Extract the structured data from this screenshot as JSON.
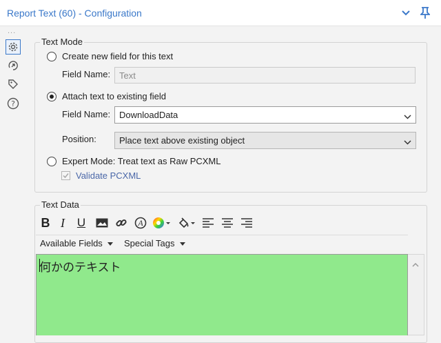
{
  "window": {
    "title": "Report Text (60) - Configuration"
  },
  "sidebar": {
    "dots": "...",
    "items": [
      "gear-icon",
      "connection-icon",
      "tag-icon",
      "help-icon"
    ]
  },
  "text_mode": {
    "legend": "Text Mode",
    "option_create": "Create new field for this text",
    "field_name_label_1": "Field Name:",
    "field_name_value_1": "Text",
    "option_attach": "Attach text to existing field",
    "field_name_label_2": "Field Name:",
    "field_name_value_2": "DownloadData",
    "position_label": "Position:",
    "position_value": "Place text above existing object",
    "option_expert": "Expert Mode: Treat text as Raw PCXML",
    "validate_label": "Validate PCXML",
    "selected_option": "attach"
  },
  "text_data": {
    "legend": "Text Data",
    "toolbar": [
      "bold",
      "italic",
      "underline",
      "image",
      "link",
      "font",
      "color",
      "fill",
      "align-left",
      "align-center",
      "align-right"
    ],
    "bold_label": "B",
    "italic_label": "I",
    "underline_label": "U",
    "menu_fields": "Available Fields",
    "menu_tags": "Special Tags",
    "content": "何かのテキスト"
  },
  "colors": {
    "accent": "#3a78c9",
    "editor_bg": "#90e98c"
  }
}
